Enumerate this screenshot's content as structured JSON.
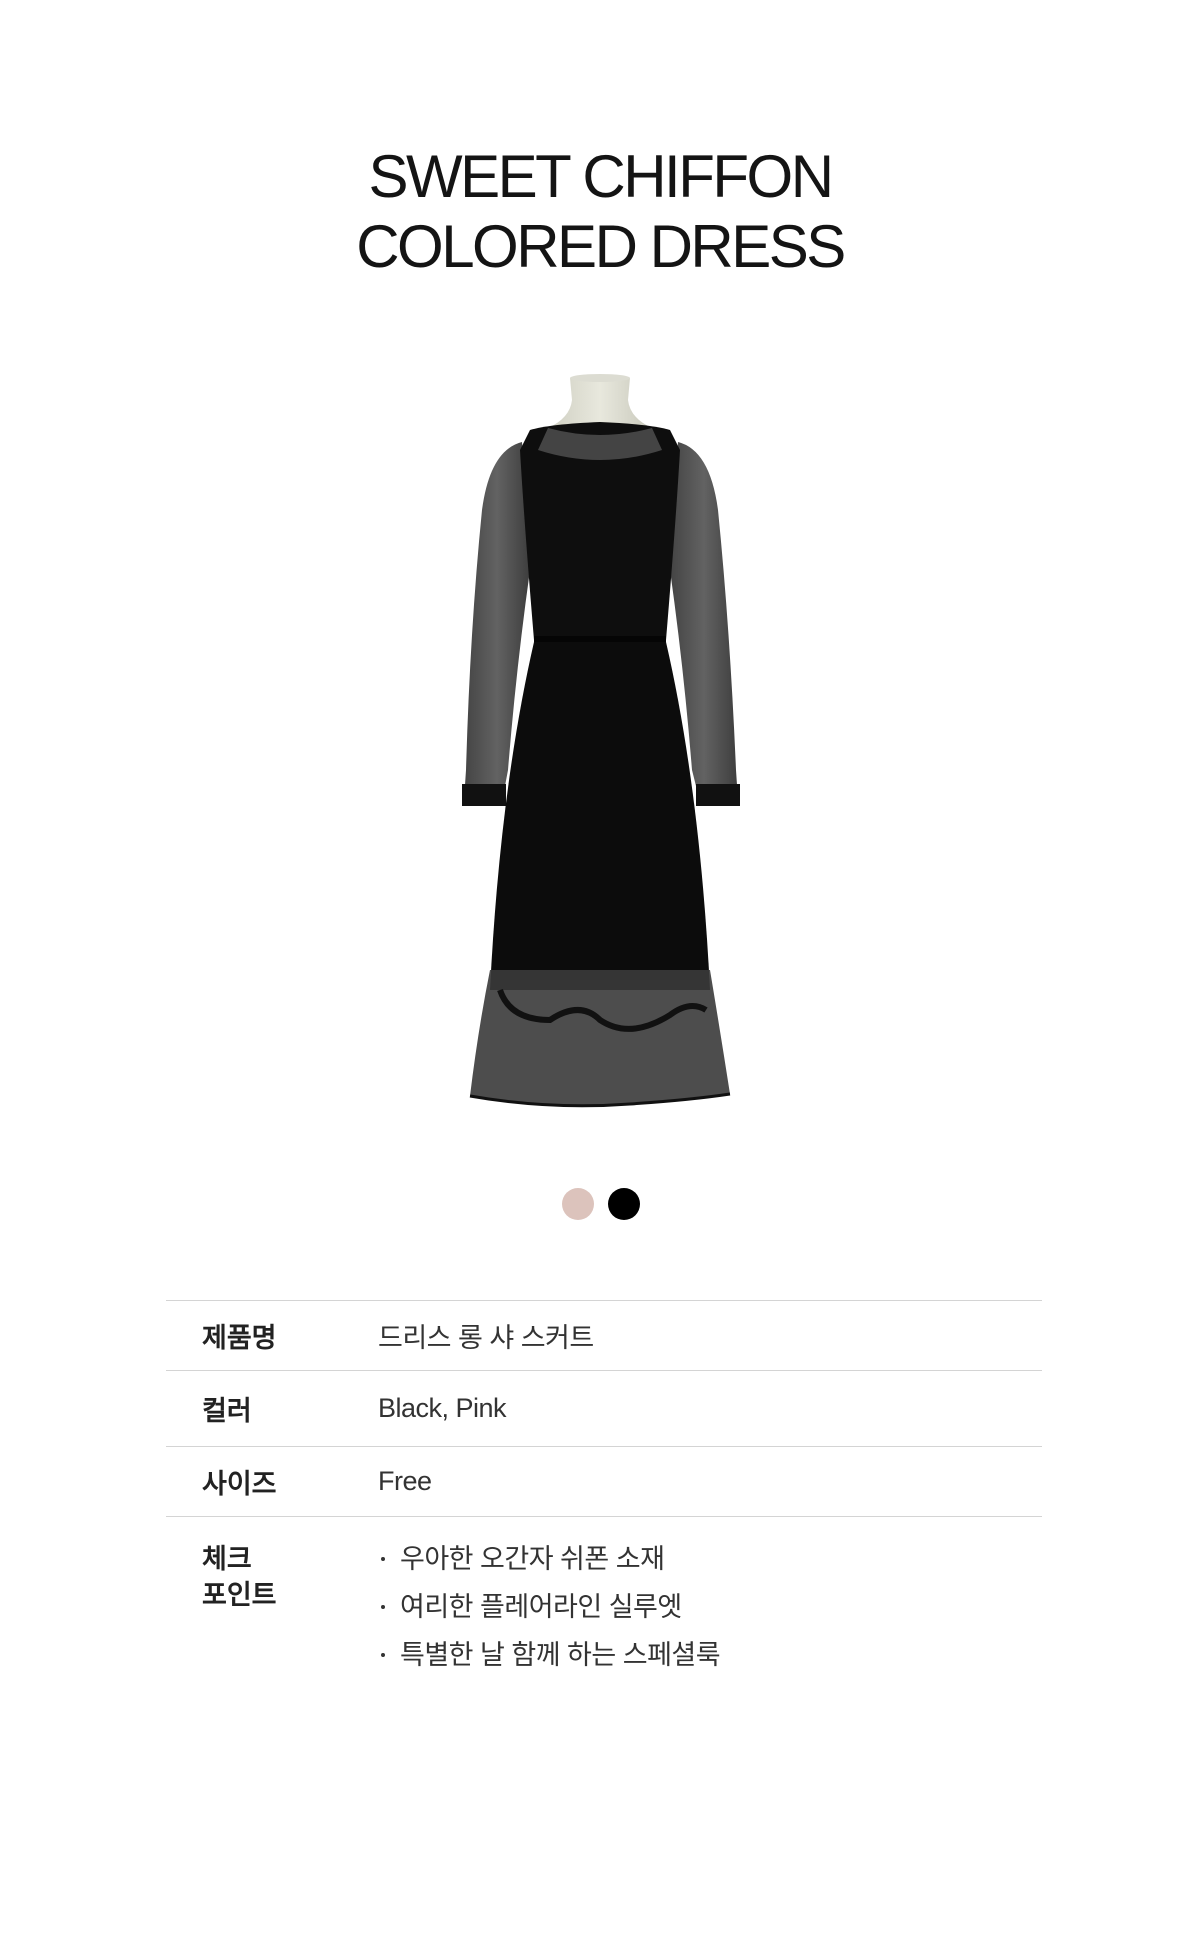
{
  "title": {
    "line1": "SWEET CHIFFON",
    "line2": "COLORED DRESS"
  },
  "product_image": {
    "icon": "black-chiffon-dress-on-mannequin"
  },
  "swatches": [
    {
      "color": "#dcc3bc"
    },
    {
      "color": "#000000"
    }
  ],
  "details": {
    "name": {
      "label": "제품명",
      "value": "드리스 롱 샤 스커트"
    },
    "color": {
      "label": "컬러",
      "value": "Black, Pink"
    },
    "size": {
      "label": "사이즈",
      "value": "Free"
    },
    "check": {
      "label_line1": "체크",
      "label_line2": "포인트",
      "points": [
        "우아한 오간자 쉬폰 소재",
        "여리한 플레어라인 실루엣",
        "특별한 날 함께 하는 스페셜룩"
      ]
    }
  }
}
